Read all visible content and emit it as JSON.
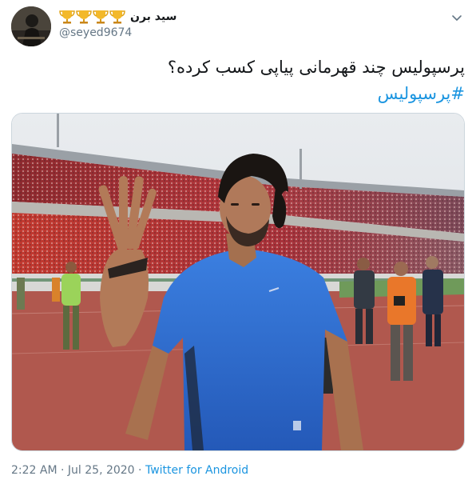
{
  "tweet": {
    "display_name": "سید برن",
    "handle": "@seyed9674",
    "badge_icons": [
      "trophy-icon",
      "trophy-icon",
      "trophy-icon",
      "trophy-icon"
    ],
    "text_line": "پرسپولیس چند قهرمانی پیاپی کسب کرده؟",
    "hashtag": "#پرسپولیس",
    "time": "2:22 AM",
    "date": "Jul 25, 2020",
    "separator": "·",
    "source": "Twitter for Android"
  },
  "colors": {
    "link": "#1b95e0",
    "secondary_text": "#657786",
    "primary_text": "#14171a",
    "border": "#ccd6dd",
    "jersey": "#2f6fd6",
    "pitch_track": "#b0584e"
  },
  "icons": {
    "menu": "chevron-down-icon",
    "badge": "trophy-icon"
  }
}
